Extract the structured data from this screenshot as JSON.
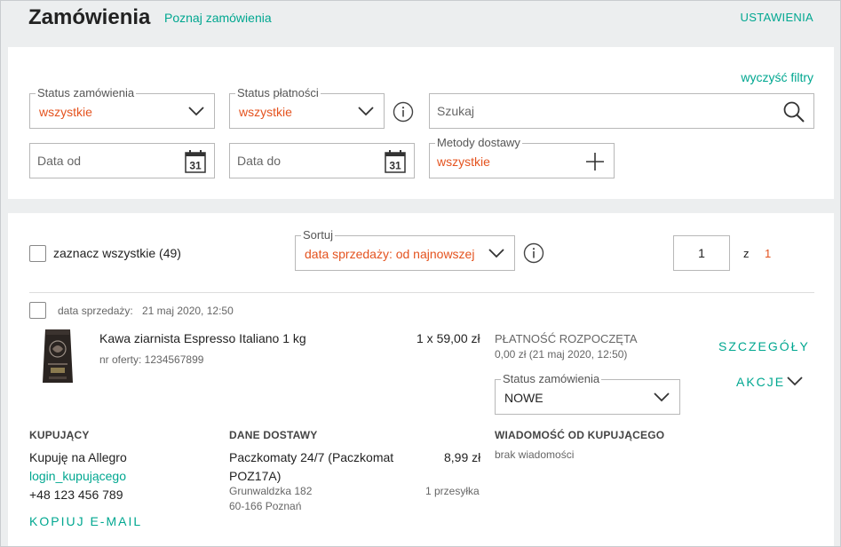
{
  "header": {
    "title": "Zamówienia",
    "learn_link": "Poznaj zamówienia",
    "settings_link": "USTAWIENIA"
  },
  "filters": {
    "clear_label": "wyczyść filtry",
    "order_status": {
      "legend": "Status zamówienia",
      "value": "wszystkie"
    },
    "payment_status": {
      "legend": "Status płatności",
      "value": "wszystkie"
    },
    "search": {
      "placeholder": "Szukaj"
    },
    "date_from": {
      "placeholder": "Data od",
      "calendar_day": "31"
    },
    "date_to": {
      "placeholder": "Data do",
      "calendar_day": "31"
    },
    "delivery_methods": {
      "legend": "Metody dostawy",
      "value": "wszystkie"
    }
  },
  "list": {
    "select_all_label": "zaznacz wszystkie (49)",
    "sort": {
      "legend": "Sortuj",
      "value": "data sprzedaży: od najnowszej"
    },
    "pagination": {
      "current": "1",
      "of_label": "z",
      "total": "1"
    }
  },
  "order": {
    "sale_date_label": "data sprzedaży:",
    "sale_date_value": "21 maj 2020, 12:50",
    "product_name": "Kawa ziarnista Espresso Italiano 1 kg",
    "offer_number": "nr oferty: 1234567899",
    "quantity_price": "1 x 59,00 zł",
    "payment_status": "PŁATNOŚĆ ROZPOCZĘTA",
    "payment_detail": "0,00 zł   (21 maj 2020, 12:50)",
    "status_legend": "Status zamówienia",
    "status_value": "NOWE",
    "details_label": "SZCZEGÓŁY",
    "actions_label": "AKCJE",
    "buyer": {
      "heading": "KUPUJĄCY",
      "name": "Kupuję na Allegro",
      "login": "login_kupującego",
      "phone": "+48 123 456 789",
      "copy_email": "KOPIUJ E-MAIL"
    },
    "delivery": {
      "heading": "DANE DOSTAWY",
      "method_line1": "Paczkomaty 24/7 (Paczkomat",
      "method_line2": "POZ17A)",
      "price": "8,99 zł",
      "address1": "Grunwaldzka 182",
      "address2": "60-166 Poznań",
      "packages": "1 przesyłka"
    },
    "message": {
      "heading": "WIADOMOŚĆ OD KUPUJĄCEGO",
      "value": "brak wiadomości"
    }
  },
  "colors": {
    "accent": "#00a790",
    "value": "#e4531f"
  }
}
